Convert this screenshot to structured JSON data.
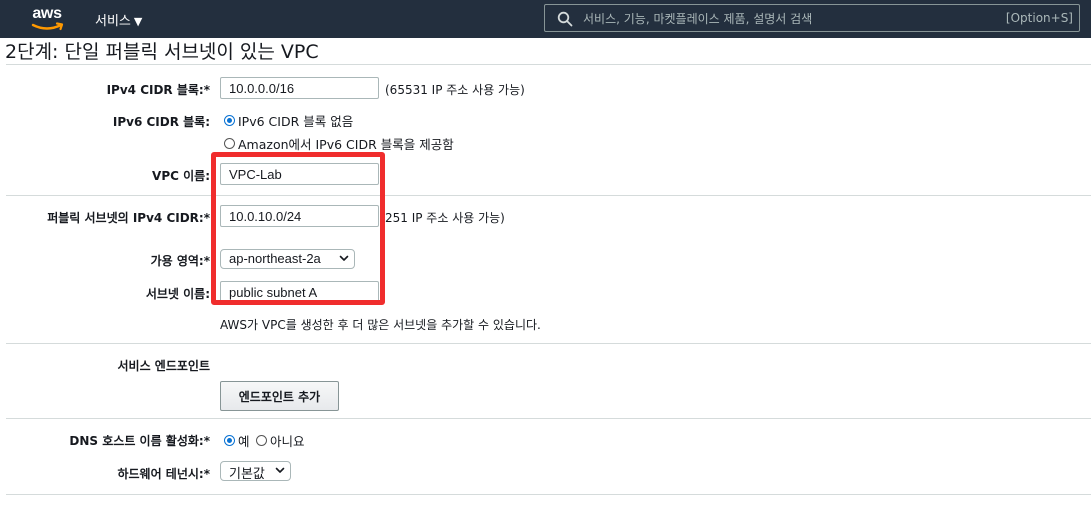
{
  "header": {
    "logo_text": "aws",
    "services_label": "서비스",
    "search_placeholder": "서비스, 기능, 마켓플레이스 제품, 설명서 검색",
    "search_shortcut": "[Option+S]"
  },
  "page": {
    "title": "2단계: 단일 퍼블릭 서브넷이 있는 VPC"
  },
  "form": {
    "ipv4_cidr": {
      "label": "IPv4 CIDR 블록:*",
      "value": "10.0.0.0/16",
      "hint": "(65531 IP 주소 사용 가능)"
    },
    "ipv6_cidr": {
      "label": "IPv6 CIDR 블록:",
      "options": [
        "IPv6 CIDR 블록 없음",
        "Amazon에서 IPv6 CIDR 블록을 제공함"
      ],
      "selected": "IPv6 CIDR 블록 없음"
    },
    "vpc_name": {
      "label": "VPC 이름:",
      "value": "VPC-Lab"
    },
    "public_subnet_cidr": {
      "label": "퍼블릭 서브넷의 IPv4 CIDR:*",
      "value": "10.0.10.0/24",
      "hint": "251 IP 주소 사용 가능)"
    },
    "availability_zone": {
      "label": "가용 영역:*",
      "value": "ap-northeast-2a"
    },
    "subnet_name": {
      "label": "서브넷 이름:",
      "value": "public subnet A"
    },
    "subnet_note": "AWS가 VPC를 생성한 후 더 많은 서브넷을 추가할 수 있습니다.",
    "endpoints": {
      "label": "서비스 엔드포인트",
      "button": "엔드포인트 추가"
    },
    "dns_hostnames": {
      "label": "DNS 호스트 이름 활성화:*",
      "options": [
        "예",
        "아니요"
      ],
      "selected": "예"
    },
    "tenancy": {
      "label": "하드웨어 테넌시:*",
      "value": "기본값"
    }
  },
  "colors": {
    "topbar": "#232f3e",
    "highlight_box": "#f02d2d",
    "radio_selected": "#0972d3"
  }
}
